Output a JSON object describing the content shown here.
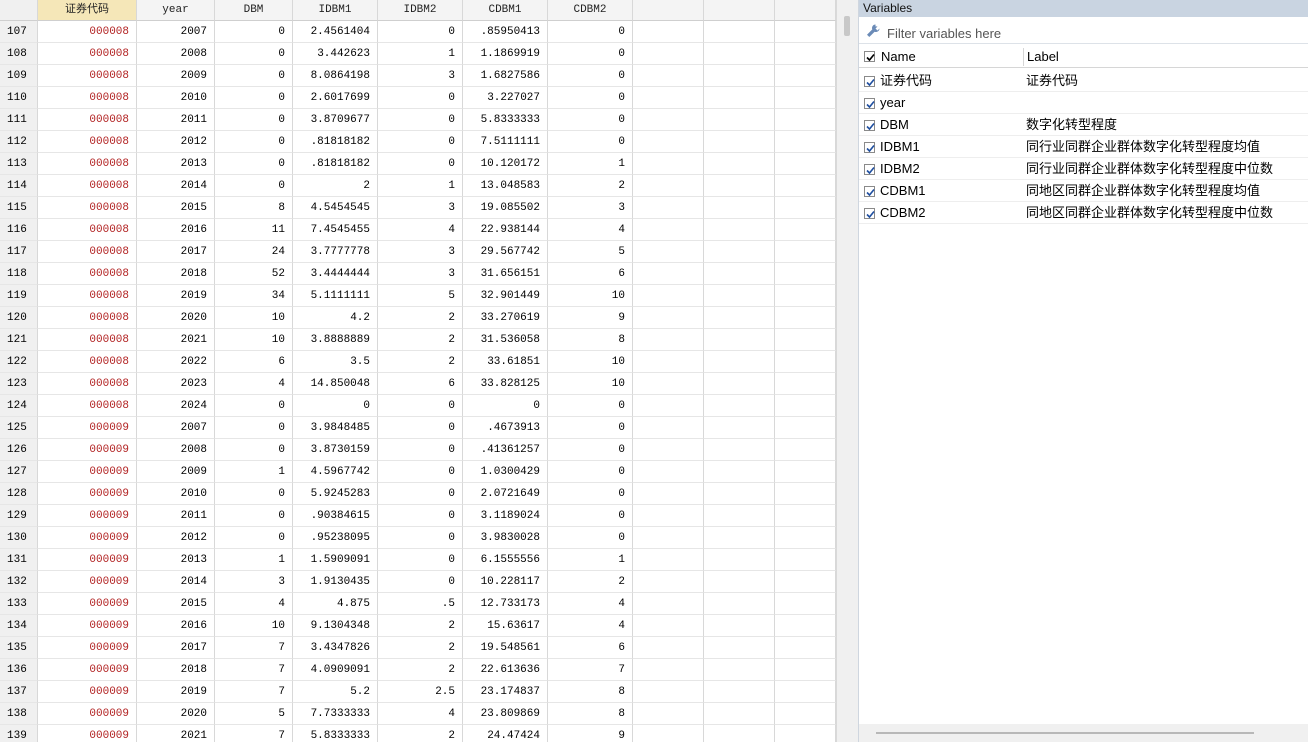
{
  "grid": {
    "columns": [
      "证券代码",
      "year",
      "DBM",
      "IDBM1",
      "IDBM2",
      "CDBM1",
      "CDBM2",
      "",
      ""
    ],
    "rows": [
      {
        "n": "107",
        "code": "000008",
        "year": "2007",
        "DBM": "0",
        "IDBM1": "2.4561404",
        "IDBM2": "0",
        "CDBM1": ".85950413",
        "CDBM2": "0"
      },
      {
        "n": "108",
        "code": "000008",
        "year": "2008",
        "DBM": "0",
        "IDBM1": "3.442623",
        "IDBM2": "1",
        "CDBM1": "1.1869919",
        "CDBM2": "0"
      },
      {
        "n": "109",
        "code": "000008",
        "year": "2009",
        "DBM": "0",
        "IDBM1": "8.0864198",
        "IDBM2": "3",
        "CDBM1": "1.6827586",
        "CDBM2": "0"
      },
      {
        "n": "110",
        "code": "000008",
        "year": "2010",
        "DBM": "0",
        "IDBM1": "2.6017699",
        "IDBM2": "0",
        "CDBM1": "3.227027",
        "CDBM2": "0"
      },
      {
        "n": "111",
        "code": "000008",
        "year": "2011",
        "DBM": "0",
        "IDBM1": "3.8709677",
        "IDBM2": "0",
        "CDBM1": "5.8333333",
        "CDBM2": "0"
      },
      {
        "n": "112",
        "code": "000008",
        "year": "2012",
        "DBM": "0",
        "IDBM1": ".81818182",
        "IDBM2": "0",
        "CDBM1": "7.5111111",
        "CDBM2": "0"
      },
      {
        "n": "113",
        "code": "000008",
        "year": "2013",
        "DBM": "0",
        "IDBM1": ".81818182",
        "IDBM2": "0",
        "CDBM1": "10.120172",
        "CDBM2": "1"
      },
      {
        "n": "114",
        "code": "000008",
        "year": "2014",
        "DBM": "0",
        "IDBM1": "2",
        "IDBM2": "1",
        "CDBM1": "13.048583",
        "CDBM2": "2"
      },
      {
        "n": "115",
        "code": "000008",
        "year": "2015",
        "DBM": "8",
        "IDBM1": "4.5454545",
        "IDBM2": "3",
        "CDBM1": "19.085502",
        "CDBM2": "3"
      },
      {
        "n": "116",
        "code": "000008",
        "year": "2016",
        "DBM": "11",
        "IDBM1": "7.4545455",
        "IDBM2": "4",
        "CDBM1": "22.938144",
        "CDBM2": "4"
      },
      {
        "n": "117",
        "code": "000008",
        "year": "2017",
        "DBM": "24",
        "IDBM1": "3.7777778",
        "IDBM2": "3",
        "CDBM1": "29.567742",
        "CDBM2": "5"
      },
      {
        "n": "118",
        "code": "000008",
        "year": "2018",
        "DBM": "52",
        "IDBM1": "3.4444444",
        "IDBM2": "3",
        "CDBM1": "31.656151",
        "CDBM2": "6"
      },
      {
        "n": "119",
        "code": "000008",
        "year": "2019",
        "DBM": "34",
        "IDBM1": "5.1111111",
        "IDBM2": "5",
        "CDBM1": "32.901449",
        "CDBM2": "10"
      },
      {
        "n": "120",
        "code": "000008",
        "year": "2020",
        "DBM": "10",
        "IDBM1": "4.2",
        "IDBM2": "2",
        "CDBM1": "33.270619",
        "CDBM2": "9"
      },
      {
        "n": "121",
        "code": "000008",
        "year": "2021",
        "DBM": "10",
        "IDBM1": "3.8888889",
        "IDBM2": "2",
        "CDBM1": "31.536058",
        "CDBM2": "8"
      },
      {
        "n": "122",
        "code": "000008",
        "year": "2022",
        "DBM": "6",
        "IDBM1": "3.5",
        "IDBM2": "2",
        "CDBM1": "33.61851",
        "CDBM2": "10"
      },
      {
        "n": "123",
        "code": "000008",
        "year": "2023",
        "DBM": "4",
        "IDBM1": "14.850048",
        "IDBM2": "6",
        "CDBM1": "33.828125",
        "CDBM2": "10"
      },
      {
        "n": "124",
        "code": "000008",
        "year": "2024",
        "DBM": "0",
        "IDBM1": "0",
        "IDBM2": "0",
        "CDBM1": "0",
        "CDBM2": "0"
      },
      {
        "n": "125",
        "code": "000009",
        "year": "2007",
        "DBM": "0",
        "IDBM1": "3.9848485",
        "IDBM2": "0",
        "CDBM1": ".4673913",
        "CDBM2": "0"
      },
      {
        "n": "126",
        "code": "000009",
        "year": "2008",
        "DBM": "0",
        "IDBM1": "3.8730159",
        "IDBM2": "0",
        "CDBM1": ".41361257",
        "CDBM2": "0"
      },
      {
        "n": "127",
        "code": "000009",
        "year": "2009",
        "DBM": "1",
        "IDBM1": "4.5967742",
        "IDBM2": "0",
        "CDBM1": "1.0300429",
        "CDBM2": "0"
      },
      {
        "n": "128",
        "code": "000009",
        "year": "2010",
        "DBM": "0",
        "IDBM1": "5.9245283",
        "IDBM2": "0",
        "CDBM1": "2.0721649",
        "CDBM2": "0"
      },
      {
        "n": "129",
        "code": "000009",
        "year": "2011",
        "DBM": "0",
        "IDBM1": ".90384615",
        "IDBM2": "0",
        "CDBM1": "3.1189024",
        "CDBM2": "0"
      },
      {
        "n": "130",
        "code": "000009",
        "year": "2012",
        "DBM": "0",
        "IDBM1": ".95238095",
        "IDBM2": "0",
        "CDBM1": "3.9830028",
        "CDBM2": "0"
      },
      {
        "n": "131",
        "code": "000009",
        "year": "2013",
        "DBM": "1",
        "IDBM1": "1.5909091",
        "IDBM2": "0",
        "CDBM1": "6.1555556",
        "CDBM2": "1"
      },
      {
        "n": "132",
        "code": "000009",
        "year": "2014",
        "DBM": "3",
        "IDBM1": "1.9130435",
        "IDBM2": "0",
        "CDBM1": "10.228117",
        "CDBM2": "2"
      },
      {
        "n": "133",
        "code": "000009",
        "year": "2015",
        "DBM": "4",
        "IDBM1": "4.875",
        "IDBM2": ".5",
        "CDBM1": "12.733173",
        "CDBM2": "4"
      },
      {
        "n": "134",
        "code": "000009",
        "year": "2016",
        "DBM": "10",
        "IDBM1": "9.1304348",
        "IDBM2": "2",
        "CDBM1": "15.63617",
        "CDBM2": "4"
      },
      {
        "n": "135",
        "code": "000009",
        "year": "2017",
        "DBM": "7",
        "IDBM1": "3.4347826",
        "IDBM2": "2",
        "CDBM1": "19.548561",
        "CDBM2": "6"
      },
      {
        "n": "136",
        "code": "000009",
        "year": "2018",
        "DBM": "7",
        "IDBM1": "4.0909091",
        "IDBM2": "2",
        "CDBM1": "22.613636",
        "CDBM2": "7"
      },
      {
        "n": "137",
        "code": "000009",
        "year": "2019",
        "DBM": "7",
        "IDBM1": "5.2",
        "IDBM2": "2.5",
        "CDBM1": "23.174837",
        "CDBM2": "8"
      },
      {
        "n": "138",
        "code": "000009",
        "year": "2020",
        "DBM": "5",
        "IDBM1": "7.7333333",
        "IDBM2": "4",
        "CDBM1": "23.809869",
        "CDBM2": "8"
      },
      {
        "n": "139",
        "code": "000009",
        "year": "2021",
        "DBM": "7",
        "IDBM1": "5.8333333",
        "IDBM2": "2",
        "CDBM1": "24.47424",
        "CDBM2": "9"
      }
    ]
  },
  "variables": {
    "title": "Variables",
    "filter_placeholder": "Filter variables here",
    "header": {
      "name": "Name",
      "label": "Label"
    },
    "items": [
      {
        "name": "证券代码",
        "label": "证券代码"
      },
      {
        "name": "year",
        "label": ""
      },
      {
        "name": "DBM",
        "label": "数字化转型程度"
      },
      {
        "name": "IDBM1",
        "label": "同行业同群企业群体数字化转型程度均值"
      },
      {
        "name": "IDBM2",
        "label": "同行业同群企业群体数字化转型程度中位数"
      },
      {
        "name": "CDBM1",
        "label": "同地区同群企业群体数字化转型程度均值"
      },
      {
        "name": "CDBM2",
        "label": "同地区同群企业群体数字化转型程度中位数"
      }
    ]
  },
  "colors": {
    "string_values": "#b22222",
    "active_header": "#f5e7b8",
    "panel_title_bg": "#c9d4e1"
  }
}
